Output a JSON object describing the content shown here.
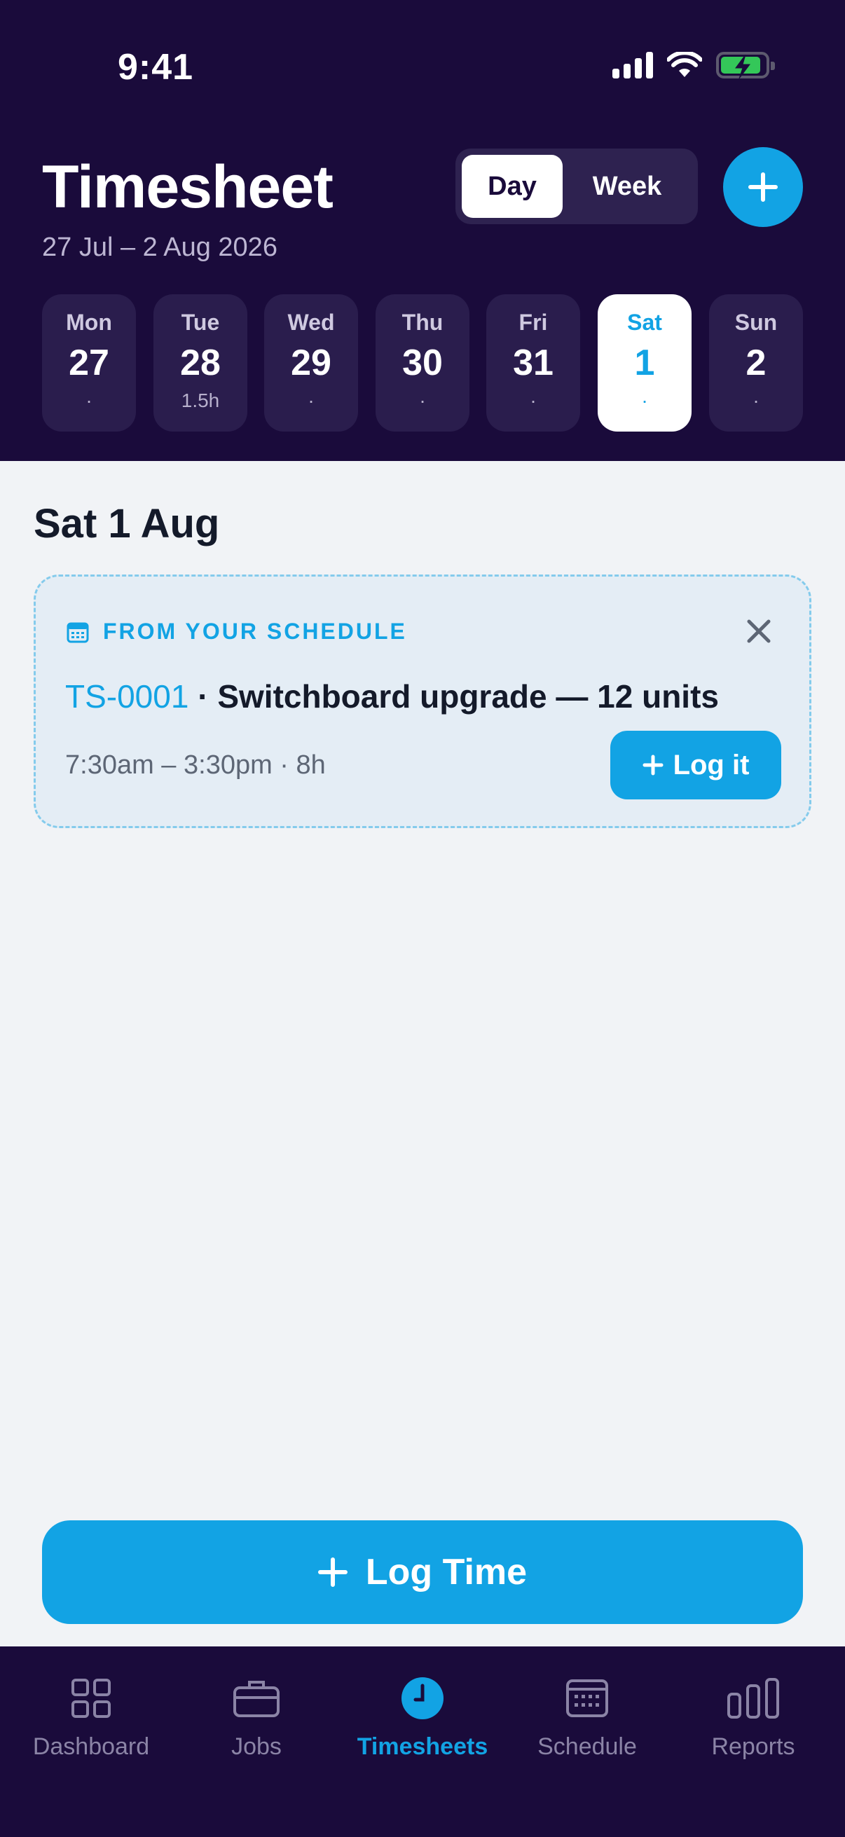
{
  "status_bar": {
    "time": "9:41"
  },
  "header": {
    "title": "Timesheet",
    "date_range": "27 Jul – 2 Aug 2026",
    "view_toggle": {
      "options": [
        "Day",
        "Week"
      ],
      "selected": "Day"
    }
  },
  "week_days": [
    {
      "name": "Mon",
      "num": "27",
      "sub": "·"
    },
    {
      "name": "Tue",
      "num": "28",
      "sub": "1.5h"
    },
    {
      "name": "Wed",
      "num": "29",
      "sub": "·"
    },
    {
      "name": "Thu",
      "num": "30",
      "sub": "·"
    },
    {
      "name": "Fri",
      "num": "31",
      "sub": "·"
    },
    {
      "name": "Sat",
      "num": "1",
      "sub": "·"
    },
    {
      "name": "Sun",
      "num": "2",
      "sub": "·"
    }
  ],
  "selected_day_index": 5,
  "main": {
    "date_heading": "Sat 1 Aug",
    "schedule_card": {
      "label": "FROM YOUR SCHEDULE",
      "job_code": "TS-0001",
      "separator": " · ",
      "job_title": "Switchboard upgrade — 12 units",
      "time": "7:30am – 3:30pm · 8h",
      "action_label": "Log it"
    },
    "primary_action_label": "Log Time"
  },
  "tab_bar": {
    "tabs": [
      {
        "label": "Dashboard",
        "icon": "grid-icon"
      },
      {
        "label": "Jobs",
        "icon": "briefcase-icon"
      },
      {
        "label": "Timesheets",
        "icon": "clock-icon"
      },
      {
        "label": "Schedule",
        "icon": "calendar-icon"
      },
      {
        "label": "Reports",
        "icon": "bar-chart-icon"
      }
    ],
    "active": "Timesheets"
  },
  "colors": {
    "header_bg": "#1a0b3b",
    "accent": "#12a3e4",
    "content_bg": "#f1f3f6",
    "card_bg": "#e4edf5"
  }
}
